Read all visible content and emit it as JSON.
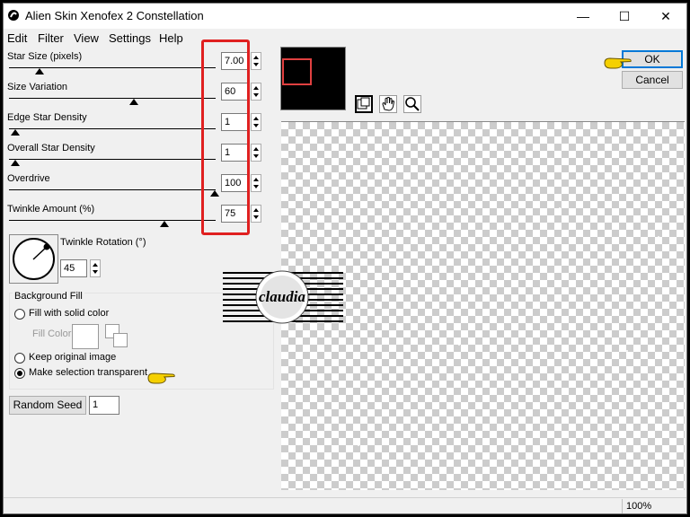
{
  "window": {
    "title": "Alien Skin Xenofex 2 Constellation"
  },
  "title_buttons": {
    "minimize": "—",
    "maximize": "☐",
    "close": "✕"
  },
  "menu": [
    "Edit",
    "Filter",
    "View",
    "Settings",
    "Help"
  ],
  "sliders": [
    {
      "label": "Star Size (pixels)",
      "value": "7.00",
      "level": 0.13
    },
    {
      "label": "Size Variation",
      "value": "60",
      "level": 0.6
    },
    {
      "label": "Edge Star Density",
      "value": "1",
      "level": 0.01
    },
    {
      "label": "Overall Star Density",
      "value": "1",
      "level": 0.01
    },
    {
      "label": "Overdrive",
      "value": "100",
      "level": 1.0
    },
    {
      "label": "Twinkle Amount (%)",
      "value": "75",
      "level": 0.75
    }
  ],
  "twinkle_rotation": {
    "label": "Twinkle Rotation (°)",
    "value": "45"
  },
  "background_fill": {
    "label": "Background Fill",
    "options": [
      {
        "label": "Fill with solid color",
        "selected": false
      },
      {
        "label": "Keep original image",
        "selected": false
      },
      {
        "label": "Make selection transparent",
        "selected": true
      }
    ],
    "fill_color_label": "Fill Color"
  },
  "random_seed": {
    "label": "Random Seed",
    "value": "1"
  },
  "buttons": {
    "ok": "OK",
    "cancel": "Cancel"
  },
  "status": {
    "zoom": "100%"
  },
  "watermark": {
    "text": "claudia"
  },
  "colors": {
    "highlight_box": "#e02020",
    "pointer_hand": "#f5d000",
    "ok_focus": "#0078d7"
  },
  "icons": [
    "app-icon",
    "zoom-preview-icon",
    "hand-icon",
    "magnifier-icon",
    "pointing-hand-icon"
  ]
}
